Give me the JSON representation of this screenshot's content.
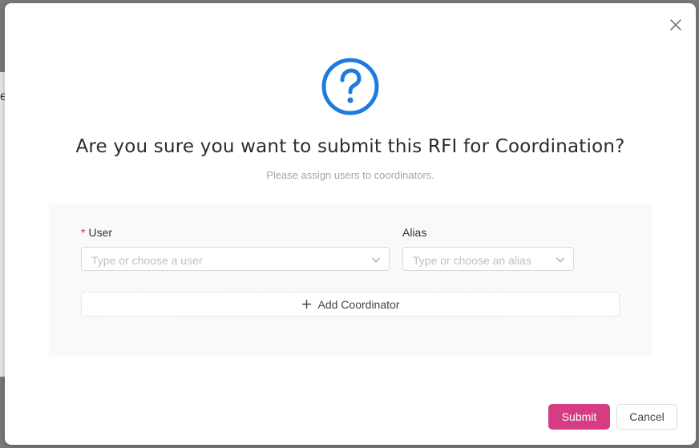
{
  "backdrop": {
    "edge_glyph": "e"
  },
  "modal": {
    "title": "Are you sure you want to submit this RFI for Coordination?",
    "subtitle": "Please assign users to coordinators.",
    "icons": {
      "close": "close-icon",
      "question": "question-circle-icon",
      "chevron": "chevron-down-icon",
      "plus": "plus-icon"
    },
    "colors": {
      "accent": "#1f7ae0",
      "submit": "#d63c84",
      "required": "#e03131"
    },
    "form": {
      "user": {
        "required_mark": "*",
        "label": "User",
        "placeholder": "Type or choose a user"
      },
      "alias": {
        "label": "Alias",
        "placeholder": "Type or choose an alias"
      },
      "add_coordinator_label": "Add Coordinator"
    },
    "footer": {
      "submit_label": "Submit",
      "cancel_label": "Cancel"
    }
  }
}
